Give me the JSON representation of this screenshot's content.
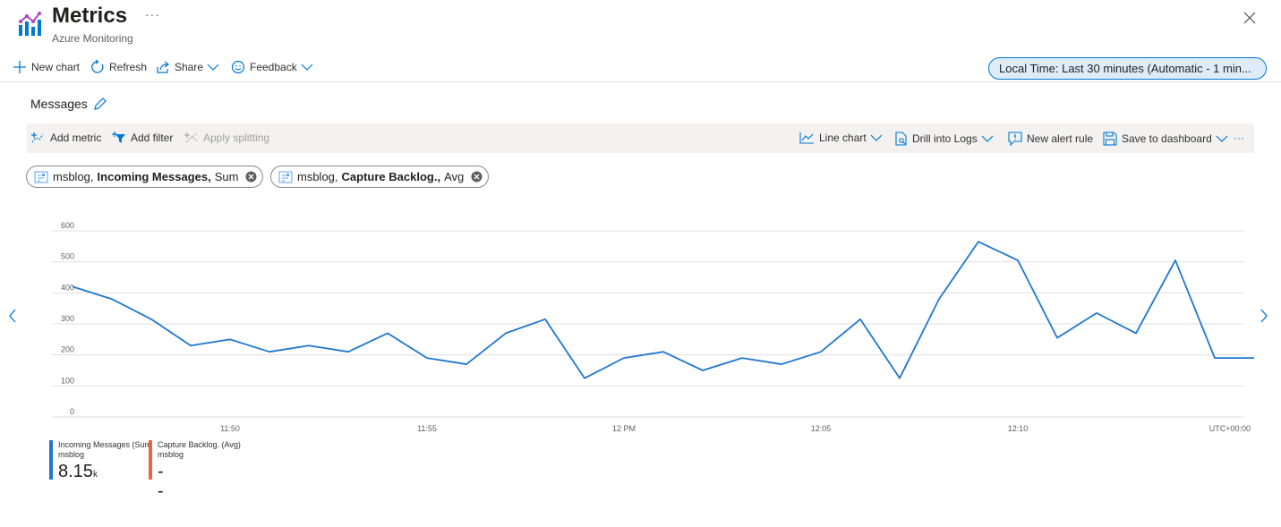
{
  "header": {
    "title": "Metrics",
    "more": "···",
    "subtitle": "Azure Monitoring",
    "icon": "metrics-icon",
    "close_icon": "close-icon"
  },
  "toolbar": {
    "new_chart": "New chart",
    "refresh": "Refresh",
    "share": "Share",
    "feedback": "Feedback",
    "time_range": "Local Time: Last 30 minutes (Automatic - 1 min..."
  },
  "chart_title": "Messages",
  "cmdbar": {
    "add_metric": "Add metric",
    "add_filter": "Add filter",
    "apply_splitting": "Apply splitting",
    "line_chart": "Line chart",
    "drill_logs": "Drill into Logs",
    "new_alert": "New alert rule",
    "save_dashboard": "Save to dashboard",
    "more": "···"
  },
  "pills": [
    {
      "resource": "msblog,",
      "metric": "Incoming Messages,",
      "agg": "Sum"
    },
    {
      "resource": "msblog,",
      "metric": "Capture Backlog.,",
      "agg": "Avg"
    }
  ],
  "colors": {
    "accent": "#0078d4",
    "series1": "#1f77d0",
    "series2": "#e8664a",
    "grid": "#e1dfdd"
  },
  "chart_data": {
    "type": "line",
    "y_ticks": [
      "600",
      "500",
      "400",
      "300",
      "200",
      "100",
      "0"
    ],
    "ylim": [
      0,
      600
    ],
    "x_tick_labels": [
      "11:50",
      "11:55",
      "12 PM",
      "12:05",
      "12:10",
      "UTC+00:00"
    ],
    "series": [
      {
        "name": "Incoming Messages (Sum)",
        "color": "#1f77d0",
        "x": [
          "11:46",
          "11:47",
          "11:48",
          "11:49",
          "11:50",
          "11:51",
          "11:52",
          "11:53",
          "11:54",
          "11:55",
          "11:56",
          "11:57",
          "11:58",
          "11:59",
          "12:00",
          "12:01",
          "12:02",
          "12:03",
          "12:04",
          "12:05",
          "12:06",
          "12:07",
          "12:08",
          "12:09",
          "12:10",
          "12:11",
          "12:12",
          "12:13",
          "12:14",
          "12:15",
          "12:16"
        ],
        "values": [
          420,
          380,
          315,
          230,
          250,
          210,
          230,
          210,
          270,
          190,
          170,
          270,
          315,
          125,
          190,
          210,
          150,
          190,
          170,
          210,
          315,
          125,
          380,
          565,
          505,
          255,
          335,
          270,
          505,
          190,
          190
        ]
      },
      {
        "name": "Capture Backlog. (Avg)",
        "color": "#e8664a",
        "x": [],
        "values": []
      }
    ]
  },
  "legend": [
    {
      "name": "Incoming Messages (Sum",
      "resource": "msblog",
      "value": "8.15",
      "unit": "k"
    },
    {
      "name": "Capture Backlog. (Avg)",
      "resource": "msblog",
      "value": "--",
      "unit": ""
    }
  ]
}
